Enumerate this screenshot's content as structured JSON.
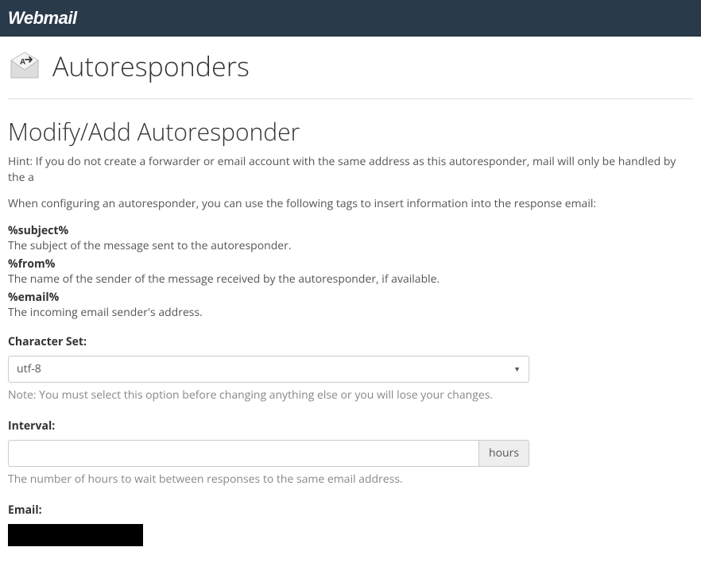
{
  "header": {
    "brand": "Webmail"
  },
  "page": {
    "title": "Autoresponders",
    "section_title": "Modify/Add Autoresponder",
    "hint": "Hint: If you do not create a forwarder or email account with the same address as this autoresponder, mail will only be handled by the a",
    "intro": "When configuring an autoresponder, you can use the following tags to insert information into the response email:"
  },
  "tags": {
    "subject": {
      "name": "%subject%",
      "desc": "The subject of the message sent to the autoresponder."
    },
    "from": {
      "name": "%from%",
      "desc": "The name of the sender of the message received by the autoresponder, if available."
    },
    "email": {
      "name": "%email%",
      "desc": "The incoming email sender's address."
    }
  },
  "form": {
    "charset": {
      "label": "Character Set:",
      "value": "utf-8",
      "note": "Note: You must select this option before changing anything else or you will lose your changes."
    },
    "interval": {
      "label": "Interval:",
      "value": "",
      "suffix": "hours",
      "note": "The number of hours to wait between responses to the same email address."
    },
    "email": {
      "label": "Email:"
    }
  }
}
